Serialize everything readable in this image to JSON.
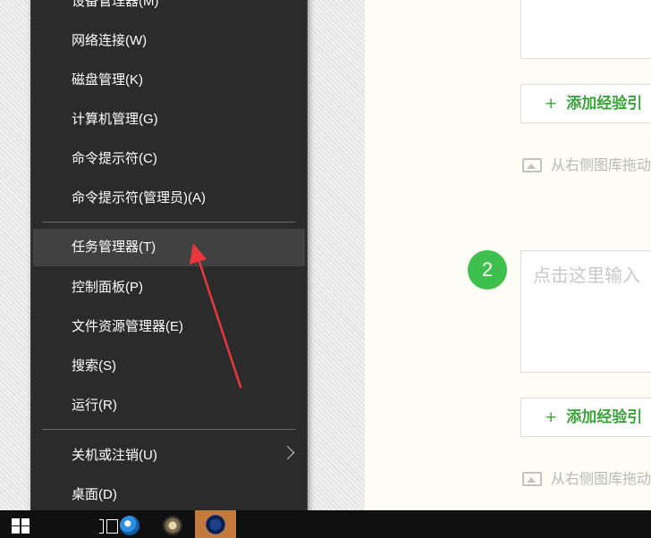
{
  "menu": {
    "items": [
      {
        "label": "设备管理器(M)"
      },
      {
        "label": "网络连接(W)"
      },
      {
        "label": "磁盘管理(K)"
      },
      {
        "label": "计算机管理(G)"
      },
      {
        "label": "命令提示符(C)"
      },
      {
        "label": "命令提示符(管理员)(A)"
      },
      {
        "label": "任务管理器(T)"
      },
      {
        "label": "控制面板(P)"
      },
      {
        "label": "文件资源管理器(E)"
      },
      {
        "label": "搜索(S)"
      },
      {
        "label": "运行(R)"
      },
      {
        "label": "关机或注销(U)"
      },
      {
        "label": "桌面(D)"
      }
    ],
    "hovered_item": "任务管理器(T)"
  },
  "editor": {
    "add_button_1": "添加经验引",
    "drag_hint_1": "从右侧图库拖动",
    "step_number": "2",
    "placeholder": "点击这里输入",
    "add_button_2": "添加经验引",
    "drag_hint_2": "从右侧图库拖动"
  },
  "annotation": {
    "color": "#e8383d"
  },
  "taskbar": {
    "icons": [
      "windows-start-icon",
      "task-view-icon",
      "browser-icon",
      "app-icon",
      "active-app-icon"
    ],
    "active_color": "#c4793d"
  }
}
